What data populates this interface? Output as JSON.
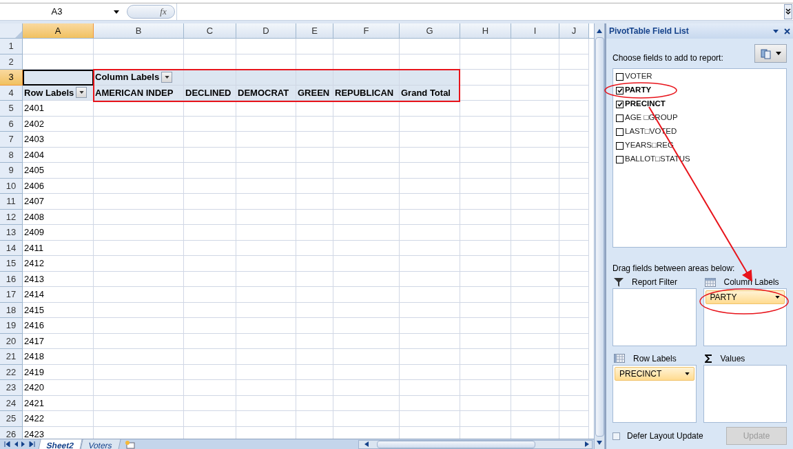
{
  "formula_bar": {
    "name_box": "A3",
    "function_button": "fx"
  },
  "columns": [
    {
      "label": "A",
      "selected": true
    },
    {
      "label": "B",
      "selected": false
    },
    {
      "label": "C",
      "selected": false
    },
    {
      "label": "D",
      "selected": false
    },
    {
      "label": "E",
      "selected": false
    },
    {
      "label": "F",
      "selected": false
    },
    {
      "label": "G",
      "selected": false
    },
    {
      "label": "H",
      "selected": false
    },
    {
      "label": "I",
      "selected": false
    },
    {
      "label": "J",
      "selected": false
    }
  ],
  "rows": [
    {
      "number": "1",
      "selected": false
    },
    {
      "number": "2",
      "selected": false
    },
    {
      "number": "3",
      "selected": true,
      "cells": [
        {
          "kind": "blank",
          "selected": true
        },
        {
          "kind": "filter",
          "text": "Column Labels",
          "selected": false
        },
        {
          "kind": "blank",
          "selected": false
        },
        {
          "kind": "blank",
          "selected": false
        },
        {
          "kind": "blank",
          "selected": false
        },
        {
          "kind": "blank",
          "selected": false
        },
        {
          "kind": "blank",
          "selected": false
        }
      ]
    },
    {
      "number": "4",
      "selected": false,
      "cells": [
        {
          "kind": "filter",
          "text": "Row Labels",
          "selected": false
        },
        {
          "kind": "header",
          "text": "AMERICAN INDEP",
          "selected": false
        },
        {
          "kind": "header",
          "text": "DECLINED",
          "selected": false
        },
        {
          "kind": "header",
          "text": "DEMOCRAT",
          "selected": false
        },
        {
          "kind": "header",
          "text": "GREEN",
          "selected": false
        },
        {
          "kind": "header",
          "text": "REPUBLICAN",
          "selected": false
        },
        {
          "kind": "header",
          "text": "Grand Total",
          "selected": false
        }
      ]
    },
    {
      "number": "5",
      "selected": false,
      "cells": [
        {
          "kind": "value",
          "text": "2401",
          "selected": false
        }
      ]
    },
    {
      "number": "6",
      "selected": false,
      "cells": [
        {
          "kind": "value",
          "text": "2402",
          "selected": false
        }
      ]
    },
    {
      "number": "7",
      "selected": false,
      "cells": [
        {
          "kind": "value",
          "text": "2403",
          "selected": false
        }
      ]
    },
    {
      "number": "8",
      "selected": false,
      "cells": [
        {
          "kind": "value",
          "text": "2404",
          "selected": false
        }
      ]
    },
    {
      "number": "9",
      "selected": false,
      "cells": [
        {
          "kind": "value",
          "text": "2405",
          "selected": false
        }
      ]
    },
    {
      "number": "10",
      "selected": false,
      "cells": [
        {
          "kind": "value",
          "text": "2406",
          "selected": false
        }
      ]
    },
    {
      "number": "11",
      "selected": false,
      "cells": [
        {
          "kind": "value",
          "text": "2407",
          "selected": false
        }
      ]
    },
    {
      "number": "12",
      "selected": false,
      "cells": [
        {
          "kind": "value",
          "text": "2408",
          "selected": false
        }
      ]
    },
    {
      "number": "13",
      "selected": false,
      "cells": [
        {
          "kind": "value",
          "text": "2409",
          "selected": false
        }
      ]
    },
    {
      "number": "14",
      "selected": false,
      "cells": [
        {
          "kind": "value",
          "text": "2411",
          "selected": false
        }
      ]
    },
    {
      "number": "15",
      "selected": false,
      "cells": [
        {
          "kind": "value",
          "text": "2412",
          "selected": false
        }
      ]
    },
    {
      "number": "16",
      "selected": false,
      "cells": [
        {
          "kind": "value",
          "text": "2413",
          "selected": false
        }
      ]
    },
    {
      "number": "17",
      "selected": false,
      "cells": [
        {
          "kind": "value",
          "text": "2414",
          "selected": false
        }
      ]
    },
    {
      "number": "18",
      "selected": false,
      "cells": [
        {
          "kind": "value",
          "text": "2415",
          "selected": false
        }
      ]
    },
    {
      "number": "19",
      "selected": false,
      "cells": [
        {
          "kind": "value",
          "text": "2416",
          "selected": false
        }
      ]
    },
    {
      "number": "20",
      "selected": false,
      "cells": [
        {
          "kind": "value",
          "text": "2417",
          "selected": false
        }
      ]
    },
    {
      "number": "21",
      "selected": false,
      "cells": [
        {
          "kind": "value",
          "text": "2418",
          "selected": false
        }
      ]
    },
    {
      "number": "22",
      "selected": false,
      "cells": [
        {
          "kind": "value",
          "text": "2419",
          "selected": false
        }
      ]
    },
    {
      "number": "23",
      "selected": false,
      "cells": [
        {
          "kind": "value",
          "text": "2420",
          "selected": false
        }
      ]
    },
    {
      "number": "24",
      "selected": false,
      "cells": [
        {
          "kind": "value",
          "text": "2421",
          "selected": false
        }
      ]
    },
    {
      "number": "25",
      "selected": false,
      "cells": [
        {
          "kind": "value",
          "text": "2422",
          "selected": false
        }
      ]
    },
    {
      "number": "26",
      "selected": false,
      "cells": [
        {
          "kind": "value",
          "text": "2423",
          "selected": false
        }
      ]
    }
  ],
  "sheet_tabs": [
    {
      "label": "Sheet2",
      "selected": true
    },
    {
      "label": "Voters",
      "selected": false
    }
  ],
  "field_list": {
    "title": "PivotTable Field List",
    "prompt": "Choose fields to add to report:",
    "fields": [
      {
        "label": "VOTER",
        "checked": false
      },
      {
        "label": "PARTY",
        "checked": true
      },
      {
        "label": "PRECINCT",
        "checked": true
      },
      {
        "label": "AGE □GROUP",
        "checked": false
      },
      {
        "label": "LAST□VOTED",
        "checked": false
      },
      {
        "label": "YEARS□REG",
        "checked": false
      },
      {
        "label": "BALLOT□STATUS",
        "checked": false
      }
    ],
    "areas_prompt": "Drag fields between areas below:",
    "areas": [
      {
        "label": "Report Filter",
        "kind": "filter"
      },
      {
        "label": "Column Labels",
        "kind": "columns",
        "fields": [
          "PARTY"
        ]
      },
      {
        "label": "Row Labels",
        "kind": "rows",
        "fields": [
          "PRECINCT"
        ]
      },
      {
        "label": "Values",
        "kind": "values"
      }
    ],
    "defer": {
      "label": "Defer Layout Update",
      "checked": false
    },
    "update_button": {
      "label": "Update",
      "disabled": true
    }
  }
}
